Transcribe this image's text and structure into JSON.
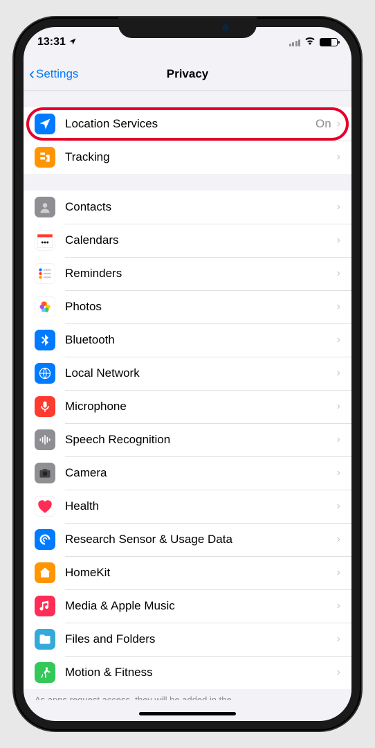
{
  "status": {
    "time": "13:31",
    "location_arrow": "➤"
  },
  "nav": {
    "back_label": "Settings",
    "title": "Privacy"
  },
  "section1": [
    {
      "id": "location-services",
      "label": "Location Services",
      "value": "On",
      "highlighted": true
    },
    {
      "id": "tracking",
      "label": "Tracking",
      "value": ""
    }
  ],
  "section2": [
    {
      "id": "contacts",
      "label": "Contacts"
    },
    {
      "id": "calendars",
      "label": "Calendars"
    },
    {
      "id": "reminders",
      "label": "Reminders"
    },
    {
      "id": "photos",
      "label": "Photos"
    },
    {
      "id": "bluetooth",
      "label": "Bluetooth"
    },
    {
      "id": "local-network",
      "label": "Local Network"
    },
    {
      "id": "microphone",
      "label": "Microphone"
    },
    {
      "id": "speech-recognition",
      "label": "Speech Recognition"
    },
    {
      "id": "camera",
      "label": "Camera"
    },
    {
      "id": "health",
      "label": "Health"
    },
    {
      "id": "research-sensor",
      "label": "Research Sensor & Usage Data"
    },
    {
      "id": "homekit",
      "label": "HomeKit"
    },
    {
      "id": "media-music",
      "label": "Media & Apple Music"
    },
    {
      "id": "files-folders",
      "label": "Files and Folders"
    },
    {
      "id": "motion-fitness",
      "label": "Motion & Fitness"
    }
  ],
  "footer_text": "As apps request access, they will be added in the"
}
